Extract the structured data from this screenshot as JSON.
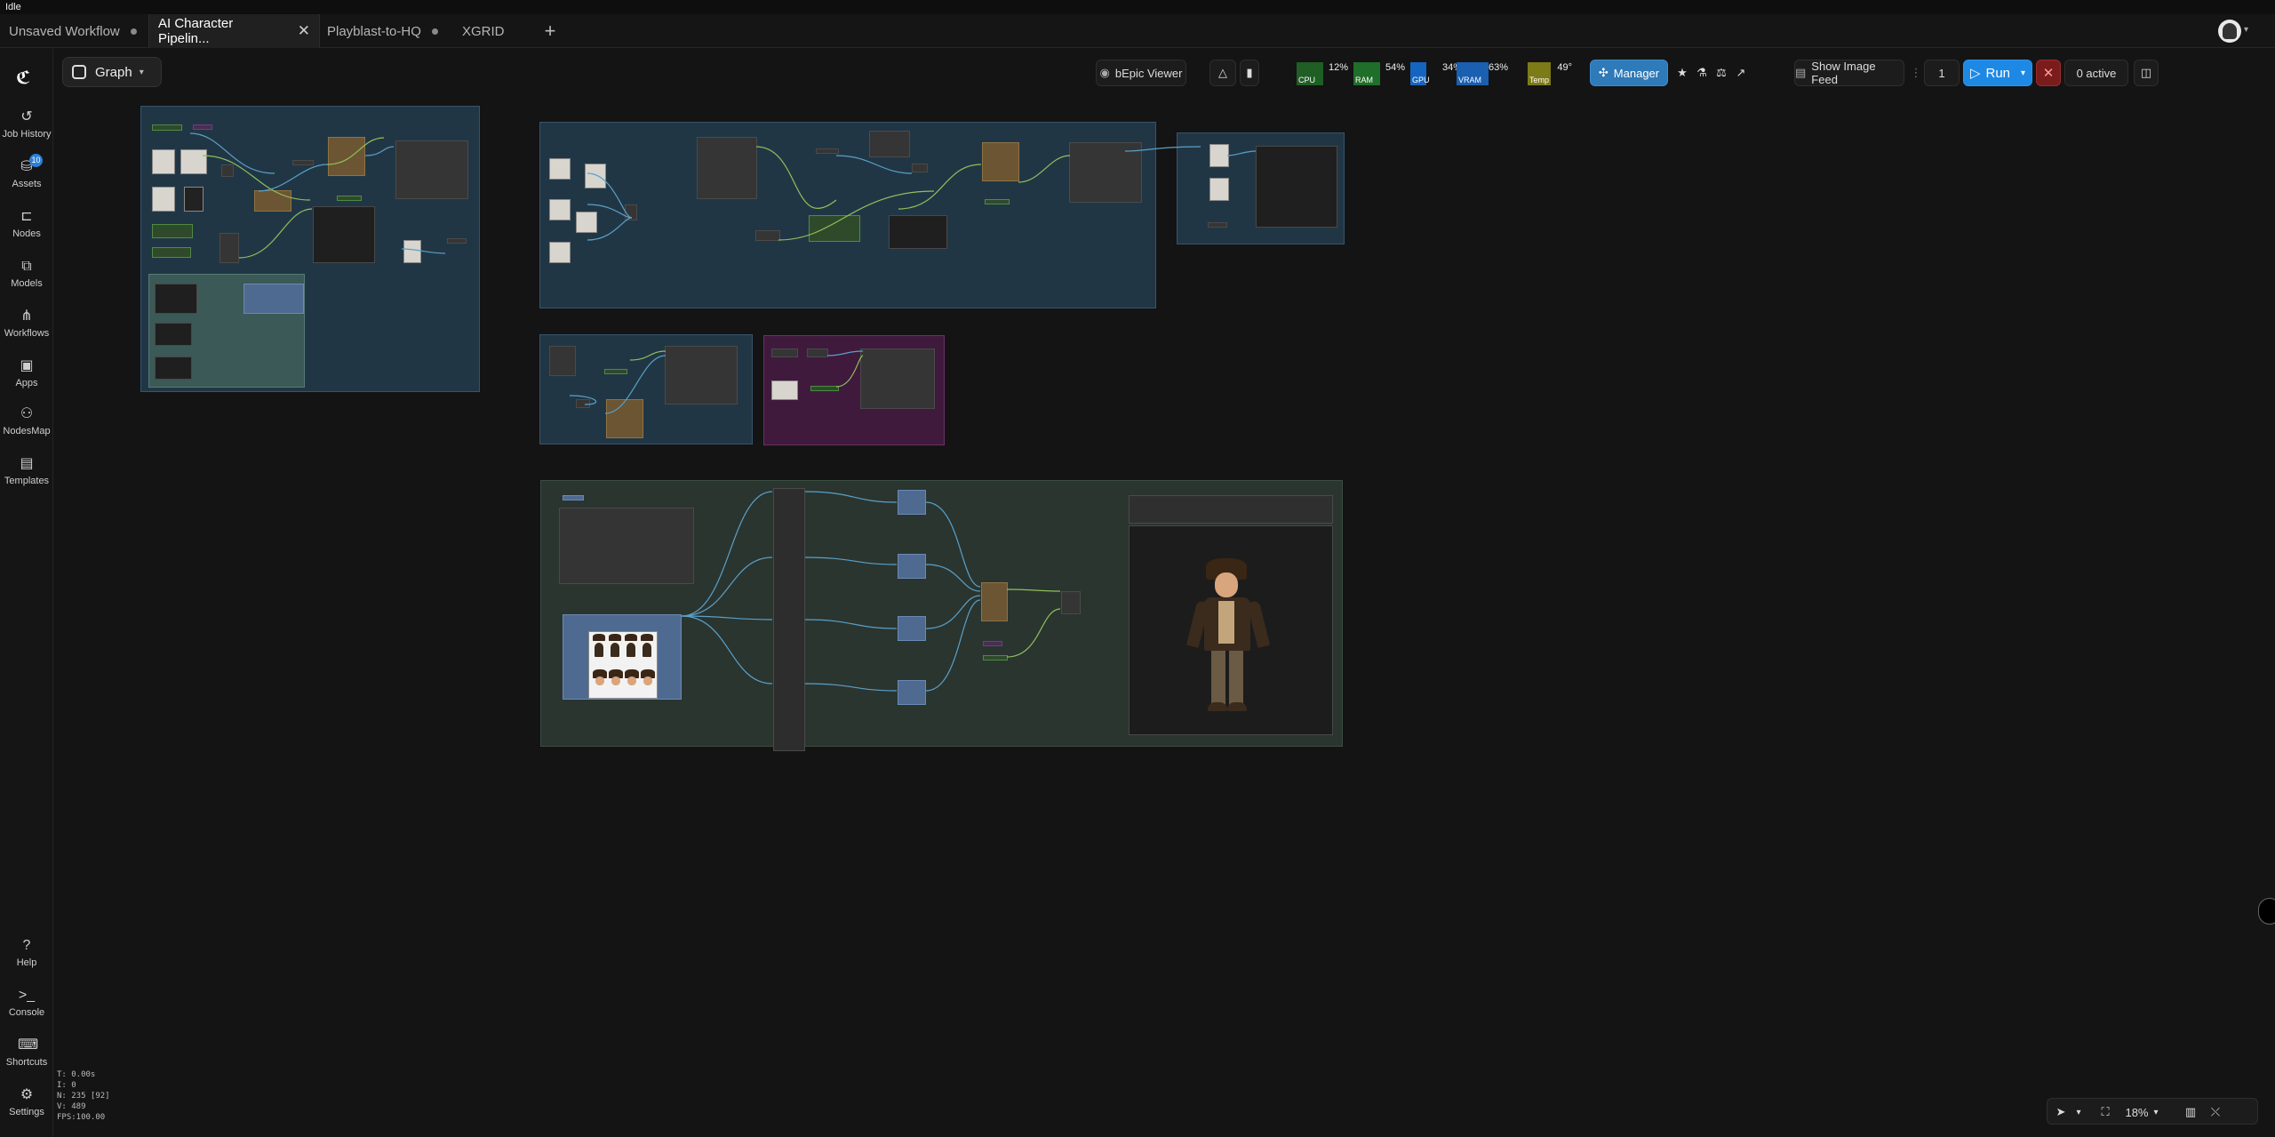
{
  "titlebar": {
    "text": "Idle"
  },
  "tabs": [
    {
      "label": "Unsaved Workflow",
      "modified": true
    },
    {
      "label": "AI Character Pipelin...",
      "active": true
    },
    {
      "label": "Playblast-to-HQ",
      "modified": true
    },
    {
      "label": "XGRID"
    }
  ],
  "sidebar": {
    "items": [
      {
        "label": "Job History",
        "icon": "history-icon"
      },
      {
        "label": "Assets",
        "icon": "assets-icon",
        "badge": "10"
      },
      {
        "label": "Nodes",
        "icon": "nodes-icon"
      },
      {
        "label": "Models",
        "icon": "models-icon"
      },
      {
        "label": "Workflows",
        "icon": "workflows-icon"
      },
      {
        "label": "Apps",
        "icon": "apps-icon"
      },
      {
        "label": "NodesMap",
        "icon": "nodesmap-icon"
      },
      {
        "label": "Templates",
        "icon": "templates-icon"
      }
    ],
    "bottom": [
      {
        "label": "Help",
        "icon": "help-icon"
      },
      {
        "label": "Console",
        "icon": "console-icon"
      },
      {
        "label": "Shortcuts",
        "icon": "keyboard-icon"
      },
      {
        "label": "Settings",
        "icon": "settings-icon"
      }
    ]
  },
  "stats": {
    "t": "T: 0.00s",
    "i": "I: 0",
    "n": "N: 235 [92]",
    "v": "V: 489",
    "fps": "FPS:100.00"
  },
  "graph_menu": {
    "label": "Graph"
  },
  "toolbar": {
    "viewer": "bEpic Viewer",
    "meters": [
      {
        "label": "CPU",
        "value": "12%",
        "color": "#2e7d32",
        "level": 0.12
      },
      {
        "label": "RAM",
        "value": "54%",
        "color": "#2e7d32",
        "level": 0.54
      },
      {
        "label": "GPU",
        "value": "34%",
        "color": "#1565c0",
        "level": 0.34
      },
      {
        "label": "VRAM",
        "value": "63%",
        "color": "#1565c0",
        "level": 0.63
      },
      {
        "label": "Temp",
        "value": "49°",
        "color": "#9e9d24",
        "level": 0.49
      }
    ],
    "manager": "Manager",
    "image_feed": "Show Image Feed",
    "queue_count": "1",
    "run": "Run",
    "active": "0 active"
  },
  "zoom": "18%",
  "colors": {
    "accent": "#1e88e5",
    "group_blue": "#213645",
    "group_purple": "#3f1a3d",
    "group_green": "#2a3530",
    "wire": "#5aa0c8",
    "wire_green": "#8fc05a"
  }
}
